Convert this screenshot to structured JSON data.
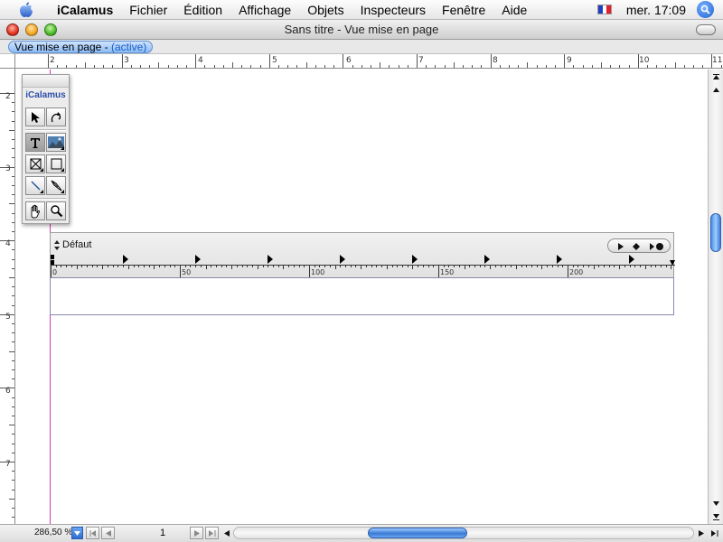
{
  "menubar": {
    "app_name": "iCalamus",
    "items": [
      "Fichier",
      "Édition",
      "Affichage",
      "Objets",
      "Inspecteurs",
      "Fenêtre",
      "Aide"
    ],
    "clock": "mer. 17:09",
    "flag_colors": [
      "#1f3fbf",
      "#ffffff",
      "#e0202a"
    ]
  },
  "window": {
    "title": "Sans titre - Vue mise en page"
  },
  "tab": {
    "label": "Vue mise en page - ",
    "status": "(active)"
  },
  "rulers": {
    "horizontal_numbers": [
      "2",
      "3",
      "4",
      "5",
      "6",
      "7",
      "8",
      "9",
      "10",
      "11"
    ],
    "vertical_numbers": [
      "2",
      "3",
      "4",
      "5",
      "6",
      "7"
    ]
  },
  "palette": {
    "title": "iCalamus",
    "tools": [
      {
        "name": "selection-arrow-icon"
      },
      {
        "name": "rotate-icon"
      },
      {
        "name": "text-tool-icon"
      },
      {
        "name": "image-tool-icon"
      },
      {
        "name": "frame-cross-icon"
      },
      {
        "name": "rectangle-icon"
      },
      {
        "name": "line-icon"
      },
      {
        "name": "pen-icon"
      },
      {
        "name": "hand-icon"
      },
      {
        "name": "magnifier-icon"
      }
    ]
  },
  "text_ruler": {
    "style": "Défaut",
    "scale_labels": [
      "0",
      "50",
      "100",
      "150",
      "200"
    ]
  },
  "statusbar": {
    "zoom": "286,50 %",
    "page": "1"
  }
}
